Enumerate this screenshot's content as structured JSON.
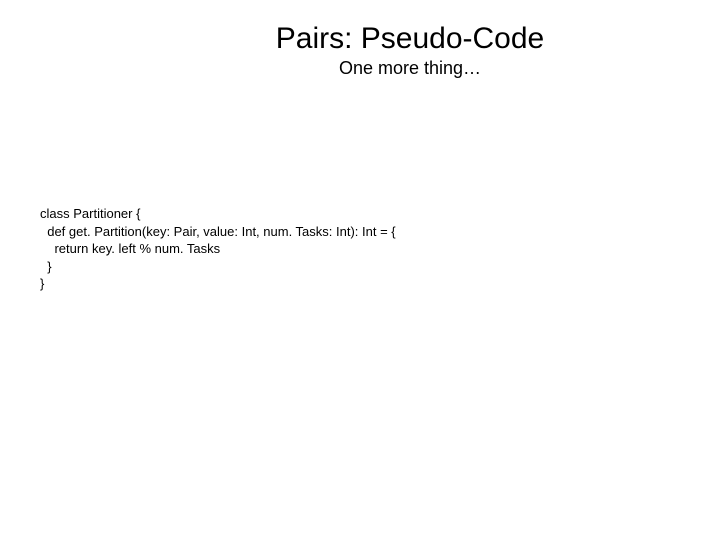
{
  "title": "Pairs: Pseudo-Code",
  "subtitle": "One more thing…",
  "code": {
    "line1": "class Partitioner {",
    "line2": "  def get. Partition(key: Pair, value: Int, num. Tasks: Int): Int = {",
    "line3": "    return key. left % num. Tasks",
    "line4": "  }",
    "line5": "}"
  }
}
